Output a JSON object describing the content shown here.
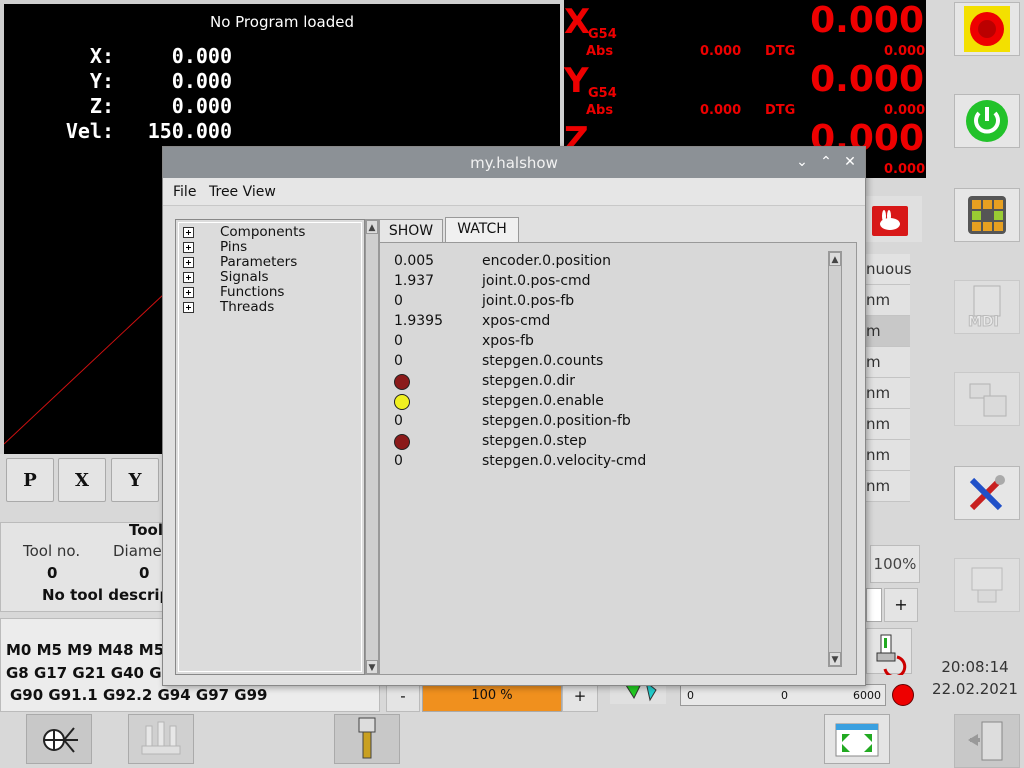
{
  "preview": {
    "title": "No Program loaded",
    "dro": [
      {
        "label": "X:",
        "value": "0.000"
      },
      {
        "label": "Y:",
        "value": "0.000"
      },
      {
        "label": "Z:",
        "value": "0.000"
      },
      {
        "label": "Vel:",
        "value": "150.000"
      }
    ],
    "view_buttons": [
      "P",
      "X",
      "Y"
    ]
  },
  "tool": {
    "header": "Tool",
    "col_no": "Tool no.",
    "col_diam": "Diamet",
    "no_value": "0",
    "diam_value": "0",
    "description": "No tool descripti"
  },
  "gcodes": {
    "line1": "M0 M5 M9 M48 M53",
    "line2": "G8 G17 G21 G40 G49",
    "line3": "G90 G91.1 G92.2 G94 G97 G99"
  },
  "axes": [
    {
      "letter": "X",
      "coord": "G54",
      "abs_label": "Abs",
      "abs_value": "0.000",
      "dtg_label": "DTG",
      "dtg_value": "0.000",
      "big_value": "0.000"
    },
    {
      "letter": "Y",
      "coord": "G54",
      "abs_label": "Abs",
      "abs_value": "0.000",
      "dtg_label": "DTG",
      "dtg_value": "0.000",
      "big_value": "0.000"
    },
    {
      "letter": "Z",
      "coord": "",
      "abs_label": "",
      "abs_value": "",
      "dtg_label": "",
      "dtg_value": "0.000",
      "big_value": "0.000"
    }
  ],
  "jog": {
    "items": [
      "nuous",
      "nm",
      "m",
      "m",
      "nm",
      "nm",
      "nm",
      "nm"
    ],
    "override": "100%",
    "plus": "+",
    "minus": "-",
    "feed_label": "100 %",
    "spindle_min": "0",
    "spindle_mid": "0",
    "spindle_max": "6000"
  },
  "clock": {
    "time": "20:08:14",
    "date": "22.02.2021"
  },
  "dialog": {
    "title": "my.halshow",
    "menu": [
      "File",
      "Tree View"
    ],
    "tree": [
      "Components",
      "Pins",
      "Parameters",
      "Signals",
      "Functions",
      "Threads"
    ],
    "tabs": [
      "SHOW",
      "WATCH"
    ],
    "watch": [
      {
        "value": "0.005",
        "name": "encoder.0.position",
        "led": ""
      },
      {
        "value": "1.937",
        "name": "joint.0.pos-cmd",
        "led": ""
      },
      {
        "value": "0",
        "name": "joint.0.pos-fb",
        "led": ""
      },
      {
        "value": "1.9395",
        "name": "xpos-cmd",
        "led": ""
      },
      {
        "value": "0",
        "name": "xpos-fb",
        "led": ""
      },
      {
        "value": "0",
        "name": "stepgen.0.counts",
        "led": ""
      },
      {
        "value": "",
        "name": "stepgen.0.dir",
        "led": "#8b1a1a"
      },
      {
        "value": "",
        "name": "stepgen.0.enable",
        "led": "#f0f020"
      },
      {
        "value": "0",
        "name": "stepgen.0.position-fb",
        "led": ""
      },
      {
        "value": "",
        "name": "stepgen.0.step",
        "led": "#8b1a1a"
      },
      {
        "value": "0",
        "name": "stepgen.0.velocity-cmd",
        "led": ""
      }
    ]
  },
  "colors": {
    "dro_red": "#e00000",
    "titlebar": "#8c9196",
    "led_off": "#8b1a1a",
    "led_on": "#f0f020",
    "feed_bar": "#f0901e"
  }
}
